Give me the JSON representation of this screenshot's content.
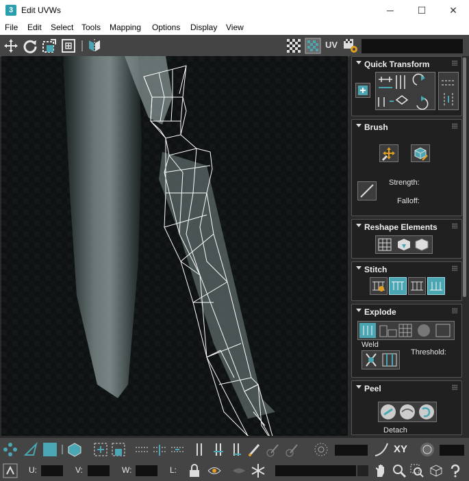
{
  "window": {
    "title": "Edit UVWs",
    "app_icon_label": "3",
    "controls": {
      "minimize": "─",
      "maximize": "☐",
      "close": "✕"
    }
  },
  "menu": [
    "File",
    "Edit",
    "Select",
    "Tools",
    "Mapping",
    "Options",
    "Display",
    "View"
  ],
  "toolbar": {
    "uv_label": "UV",
    "icons": [
      "move-icon",
      "rotate-icon",
      "scale-icon",
      "freeform-icon",
      "mirror-icon",
      "checker-icon",
      "checker-toggle-icon",
      "uv-space-icon",
      "uv-settings-icon"
    ],
    "accent_color": "#4aa6b2"
  },
  "panels": {
    "quick_transform": {
      "title": "Quick Transform"
    },
    "brush": {
      "title": "Brush",
      "strength_label": "Strength:",
      "falloff_label": "Falloff:"
    },
    "reshape": {
      "title": "Reshape Elements"
    },
    "stitch": {
      "title": "Stitch"
    },
    "explode": {
      "title": "Explode",
      "weld_label": "Weld",
      "threshold_label": "Threshold:"
    },
    "peel": {
      "title": "Peel",
      "detach_label": "Detach"
    }
  },
  "bottom": {
    "xy_label": "XY",
    "u_label": "U:",
    "v_label": "V:",
    "w_label": "W:",
    "l_label": "L:",
    "u_value": "",
    "v_value": "",
    "w_value": "",
    "l_value": ""
  }
}
